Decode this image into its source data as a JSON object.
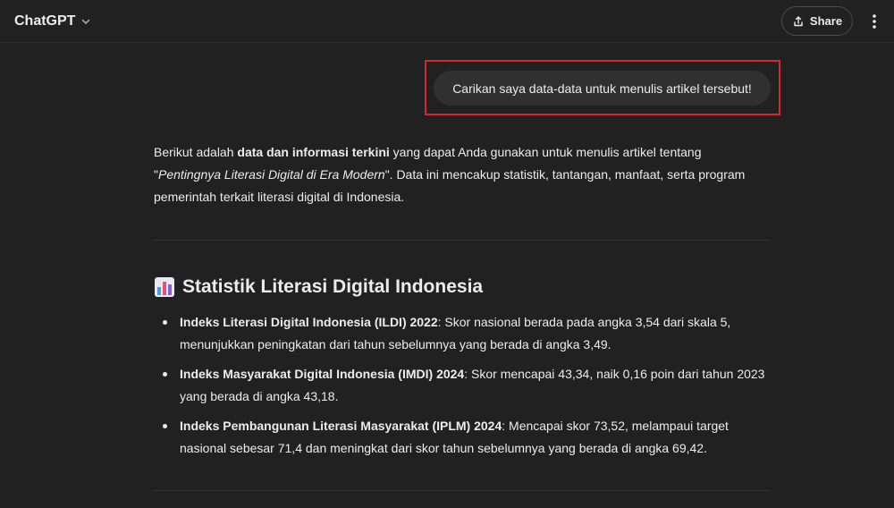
{
  "header": {
    "model_name": "ChatGPT",
    "share_label": "Share"
  },
  "user_message": {
    "text": "Carikan saya data-data untuk menulis artikel tersebut!"
  },
  "assistant": {
    "intro_part1": "Berikut adalah ",
    "intro_bold": "data dan informasi terkini",
    "intro_part2": " yang dapat Anda gunakan untuk menulis artikel tentang",
    "intro_quote_open": "\"",
    "intro_italic": "Pentingnya Literasi Digital di Era Modern",
    "intro_quote_close": "\"",
    "intro_part3": ". Data ini mencakup statistik, tantangan, manfaat, serta program",
    "intro_part4": "pemerintah terkait literasi digital di Indonesia.",
    "section_title": "Statistik Literasi Digital Indonesia",
    "section_icon": "bar-chart-emoji",
    "bullets": [
      {
        "bold": "Indeks Literasi Digital Indonesia (ILDI) 2022",
        "line1": ": Skor nasional berada pada angka 3,54 dari skala 5,",
        "line2": "menunjukkan peningkatan dari tahun sebelumnya yang berada di angka 3,49."
      },
      {
        "bold": "Indeks Masyarakat Digital Indonesia (IMDI) 2024",
        "line1": ": Skor mencapai 43,34, naik 0,16 poin dari tahun 2023",
        "line2": "yang berada di angka 43,18."
      },
      {
        "bold": "Indeks Pembangunan Literasi Masyarakat (IPLM) 2024",
        "line1": ": Mencapai skor 73,52, melampaui target",
        "line2": "nasional sebesar 71,4 dan meningkat dari skor tahun sebelumnya yang berada di angka 69,42."
      }
    ]
  },
  "colors": {
    "background": "#212121",
    "user_bubble": "#303030",
    "highlight_border": "#d9262a",
    "text": "#ececec"
  }
}
